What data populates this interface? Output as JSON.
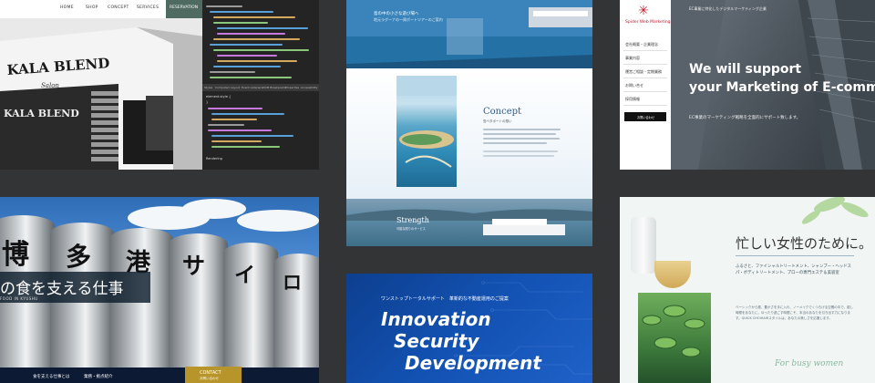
{
  "card1": {
    "nav": [
      "HOME",
      "SHOP",
      "CONCEPT",
      "SERVICES",
      "RESERVATION"
    ],
    "sign_text": "KALA BLEND",
    "sign_sub": "Salon",
    "devtools_tabs": [
      "Styles",
      "Computed",
      "Layout",
      "Event Listeners",
      "DOM Breakpoints",
      "Properties",
      "Accessibility"
    ],
    "code_snippets": [
      "element.style {",
      "}",
      "Rendering"
    ]
  },
  "card2": {
    "top_line1": "島の中の小さな遊び場へ",
    "top_line2": "地元ラグーナの一周ボートツアーのご案内",
    "concept_title": "Concept",
    "concept_sub": "島ベタボートの想い",
    "strength_title": "Strength",
    "strength_sub": "可能な限りのサービス"
  },
  "card3": {
    "brand": "Spider Web Marketing",
    "topbar": "EC事業に特化したデジタルマーケティング企業",
    "menu": [
      "会社概要・企業理念",
      "事業内容",
      "運営ご相談・定期業務",
      "お問い合せ",
      "採用情報"
    ],
    "contact_btn": "お問い合わせ",
    "headline1": "We will support",
    "headline2": "your Marketing of E-commerce",
    "subline": "EC事業のマーケティング戦略を全面的にサポート致します。"
  },
  "card4": {
    "kanji": [
      "博",
      "多",
      "港",
      "サ",
      "イ",
      "ロ"
    ],
    "band_jp": "の食を支える仕事",
    "band_en": "FOOD IN KYUSHU",
    "foot_items": [
      "食を支える仕事とは",
      "業務・拠点紹介"
    ],
    "contact_en": "CONTACT",
    "contact_jp": "お問い合わせ"
  },
  "card5": {
    "tagline": "ワンストップトータルサポート　革新的な不動産運用のご提案",
    "line1": "Innovation",
    "line2": "Security",
    "line3": "Development"
  },
  "card6": {
    "title": "忙しい女性のために。",
    "lead": "ふるさと、ファイシャルトリートメント、シャンプー・ヘッドスパ・ボディトリートメント、プローの専門エステ＆美容室",
    "body": "ベーシックから癒、豊かさを手に入れ、ノーメイクでくつろげる空間の中で、癒し時間をあなたに。ゆったり過ごす時間こそ、本当のあなたを引き出す力になります。QUICK CHOIHAIRスタイルは、あなたの美しさを応援します。",
    "signature": "For busy women"
  }
}
